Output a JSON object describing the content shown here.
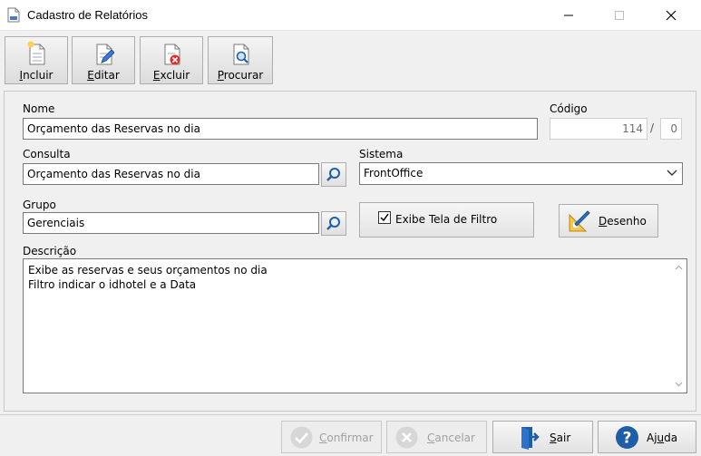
{
  "window": {
    "title": "Cadastro de Relatórios",
    "minimize_icon": "minimize-icon",
    "maximize_icon": "maximize-icon",
    "close_icon": "close-icon"
  },
  "toolbar": {
    "incluir": {
      "first": "I",
      "rest": "ncluir",
      "icon": "new-document-icon"
    },
    "editar": {
      "first": "E",
      "rest": "ditar",
      "icon": "edit-document-icon"
    },
    "excluir": {
      "first": "E",
      "rest": "xcluir",
      "icon": "delete-document-icon"
    },
    "procurar": {
      "first": "P",
      "rest": "rocurar",
      "icon": "search-document-icon"
    }
  },
  "form": {
    "nome_label": "Nome",
    "nome_value": "Orçamento das Reservas no dia",
    "codigo_label": "Código",
    "codigo_value": "114",
    "codigo_separator": "/",
    "codigo_sub_value": "0",
    "consulta_label": "Consulta",
    "consulta_value": "Orçamento das Reservas no dia",
    "sistema_label": "Sistema",
    "sistema_value": "FrontOffice",
    "grupo_label": "Grupo",
    "grupo_value": "Gerenciais",
    "exibe_filtro_label": "Exibe Tela de Filtro",
    "exibe_filtro_checked": true,
    "desenho": {
      "first": "D",
      "rest": "esenho"
    },
    "descricao_label": "Descrição",
    "descricao_lines": [
      "Exibe as reservas e seus orçamentos no dia",
      "Filtro indicar o idhotel e a Data"
    ]
  },
  "bottom": {
    "confirmar": {
      "first": "C",
      "rest": "onfirmar",
      "enabled": false
    },
    "cancelar": {
      "first": "C",
      "rest": "ancelar",
      "enabled": false
    },
    "sair": {
      "first": "S",
      "rest": "air",
      "enabled": true
    },
    "ajuda": {
      "pre": "Aj",
      "under": "u",
      "post": "da",
      "enabled": true
    }
  },
  "colors": {
    "help_blue": "#1e5ea8",
    "search_blue": "#1f5fa8",
    "delete_red": "#d9342b"
  }
}
